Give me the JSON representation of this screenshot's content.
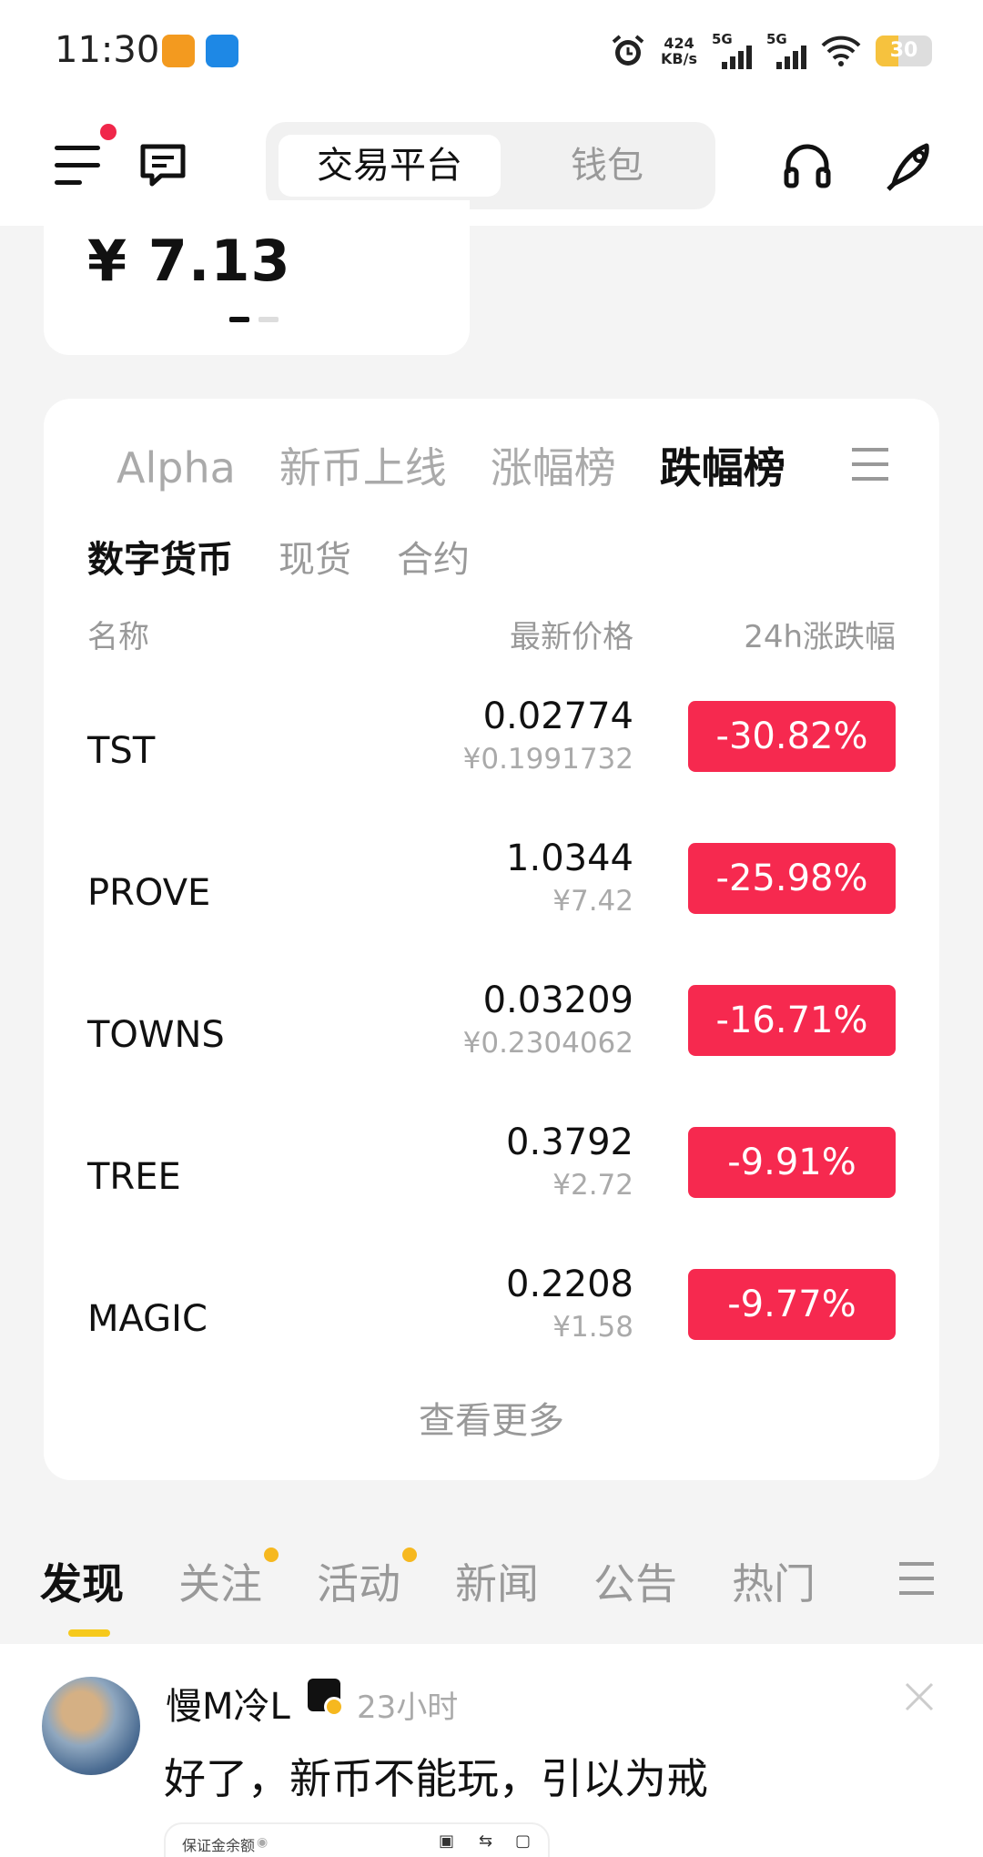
{
  "status_bar": {
    "time": "11:30",
    "net_speed_value": "424",
    "net_speed_unit": "KB/s",
    "sim1_label": "5G",
    "sim2_label": "5G",
    "battery": "30",
    "icons": [
      "alarm-icon",
      "wifi-icon",
      "battery-icon"
    ]
  },
  "header": {
    "segment_active": "交易平台",
    "segment_inactive": "钱包",
    "icons": [
      "menu-icon",
      "message-icon",
      "headset-icon",
      "rocket-icon"
    ]
  },
  "balance": {
    "value": "¥ 7.13"
  },
  "market": {
    "tabs": [
      "Alpha",
      "新币上线",
      "涨幅榜",
      "跌幅榜"
    ],
    "active_tab": "跌幅榜",
    "subtabs": [
      "数字货币",
      "现货",
      "合约"
    ],
    "active_subtab": "数字货币",
    "columns": {
      "name": "名称",
      "price": "最新价格",
      "change": "24h涨跌幅"
    },
    "rows": [
      {
        "symbol": "TST",
        "price": "0.02774",
        "cny": "¥0.1991732",
        "change": "-30.82%"
      },
      {
        "symbol": "PROVE",
        "price": "1.0344",
        "cny": "¥7.42",
        "change": "-25.98%"
      },
      {
        "symbol": "TOWNS",
        "price": "0.03209",
        "cny": "¥0.2304062",
        "change": "-16.71%"
      },
      {
        "symbol": "TREE",
        "price": "0.3792",
        "cny": "¥2.72",
        "change": "-9.91%"
      },
      {
        "symbol": "MAGIC",
        "price": "0.2208",
        "cny": "¥1.58",
        "change": "-9.77%"
      }
    ],
    "view_more": "查看更多",
    "negative_color": "#f6294f"
  },
  "feed": {
    "tabs": [
      "发现",
      "关注",
      "活动",
      "新闻",
      "公告",
      "热门"
    ],
    "active_tab": "发现",
    "dotted_tabs": [
      "关注",
      "活动"
    ],
    "accent_color": "#f6c91c"
  },
  "post": {
    "username": "慢M冷L",
    "time": "23小时",
    "text": "好了，新币不能玩，引以为戒",
    "embed_label": "保证金余额"
  }
}
